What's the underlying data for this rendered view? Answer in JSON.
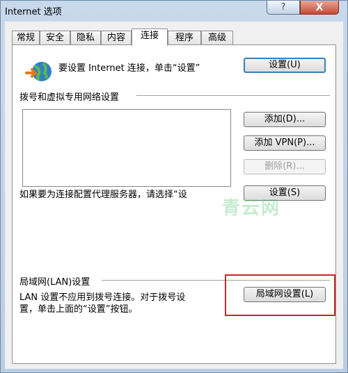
{
  "window": {
    "title": "Internet 选项",
    "help_label": "?",
    "close_label": "X"
  },
  "tabs": [
    {
      "label": "常规"
    },
    {
      "label": "安全"
    },
    {
      "label": "隐私"
    },
    {
      "label": "内容"
    },
    {
      "label": "连接"
    },
    {
      "label": "程序"
    },
    {
      "label": "高级"
    }
  ],
  "connection": {
    "setup_text": "要设置 Internet 连接，单击“设置”",
    "setup_button": "设置(U)",
    "dialup_heading": "拨号和虚拟专用网络设置",
    "add_button": "添加(D)...",
    "add_vpn_button": "添加 VPN(P)...",
    "remove_button": "删除(R)...",
    "proxy_text": "如果要为连接配置代理服务器，请选择“设",
    "settings_button": "设置(S)"
  },
  "lan": {
    "heading": "局域网(LAN)设置",
    "description_line1": "LAN 设置不应用到拨号连接。对于拨号设",
    "description_line2": "置，单击上面的“设置”按钮。",
    "lan_button": "局域网设置(L)"
  },
  "watermark": "青云网",
  "colors": {
    "highlight": "#c0282b",
    "focus": "#3c7fb1"
  }
}
